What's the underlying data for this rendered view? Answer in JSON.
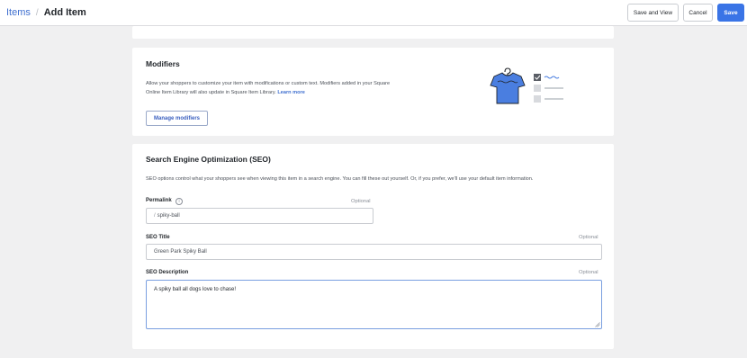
{
  "header": {
    "breadcrumb_root": "Items",
    "breadcrumb_separator": "/",
    "page_title": "Add Item",
    "save_and_view_label": "Save and View",
    "cancel_label": "Cancel",
    "save_label": "Save"
  },
  "colors": {
    "accent": "#3a74e6",
    "link": "#3f6fcf",
    "illustration_shirt": "#4a7ee0"
  },
  "modifiers": {
    "title": "Modifiers",
    "description_line1": "Allow your shoppers to customize your item with modifications or custom text. Modifiers added in your Square",
    "description_line2": "Online Item Library will also update in Square Item Library.",
    "learn_more": "Learn more",
    "manage_button": "Manage modifiers",
    "illustration_icon": "shirt-with-checklist-illustration"
  },
  "seo": {
    "title": "Search Engine Optimization (SEO)",
    "description": "SEO options control what your shoppers see when viewing this item in a search engine. You can fill these out yourself. Or, if you prefer, we'll use your default item information.",
    "permalink_label": "Permalink",
    "permalink_optional": "Optional",
    "permalink_prefix": "/",
    "permalink_value": "spiky-ball",
    "seo_title_label": "SEO Title",
    "seo_title_optional": "Optional",
    "seo_title_value": "Green Park Spiky Ball",
    "seo_description_label": "SEO Description",
    "seo_description_optional": "Optional",
    "seo_description_value": "A spiky ball all dogs love to chase!"
  }
}
